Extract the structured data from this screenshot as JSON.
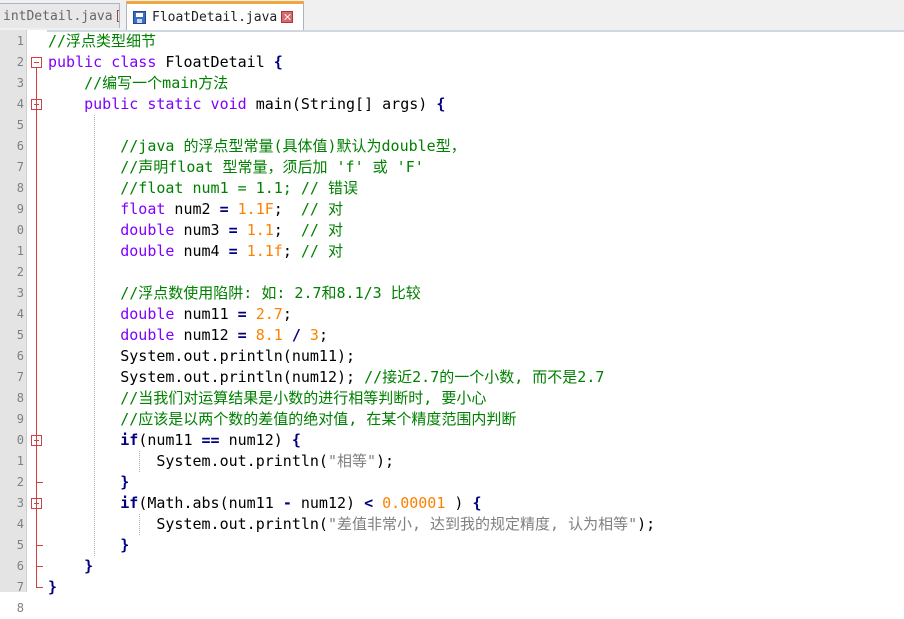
{
  "tabs": [
    {
      "label": "FloatDetail.java",
      "visible_label": "intDetail.java",
      "active": false
    },
    {
      "label": "FloatDetail.java",
      "active": true
    }
  ],
  "line_numbers": [
    "1",
    "2",
    "3",
    "4",
    "5",
    "6",
    "7",
    "8",
    "9",
    "0",
    "1",
    "2",
    "3",
    "4",
    "5",
    "6",
    "7",
    "8",
    "9",
    "0",
    "1",
    "2",
    "3",
    "4",
    "5",
    "6",
    "7",
    "8"
  ],
  "code_lines": [
    [
      {
        "t": "//浮点类型细节",
        "c": "cm"
      }
    ],
    [
      {
        "t": "public class",
        "c": "kw"
      },
      {
        "t": " FloatDetail ",
        "c": "tx"
      },
      {
        "t": "{",
        "c": "op"
      }
    ],
    [
      {
        "t": "    //编写一个main方法",
        "c": "cm"
      }
    ],
    [
      {
        "t": "    ",
        "c": "tx"
      },
      {
        "t": "public static void",
        "c": "kw"
      },
      {
        "t": " main(String[] args) ",
        "c": "tx"
      },
      {
        "t": "{",
        "c": "op"
      }
    ],
    [],
    [
      {
        "t": "        //java 的浮点型常量(具体值)默认为double型，",
        "c": "cm"
      }
    ],
    [
      {
        "t": "        //声明float 型常量，须后加 'f' 或 'F'",
        "c": "cm"
      }
    ],
    [
      {
        "t": "        //float num1 = 1.1; // 错误",
        "c": "cm"
      }
    ],
    [
      {
        "t": "        ",
        "c": "tx"
      },
      {
        "t": "float",
        "c": "kw"
      },
      {
        "t": " num2 ",
        "c": "tx"
      },
      {
        "t": "=",
        "c": "op"
      },
      {
        "t": " ",
        "c": "tx"
      },
      {
        "t": "1.1F",
        "c": "num"
      },
      {
        "t": ";  ",
        "c": "tx"
      },
      {
        "t": "// 对",
        "c": "cm"
      }
    ],
    [
      {
        "t": "        ",
        "c": "tx"
      },
      {
        "t": "double",
        "c": "kw"
      },
      {
        "t": " num3 ",
        "c": "tx"
      },
      {
        "t": "=",
        "c": "op"
      },
      {
        "t": " ",
        "c": "tx"
      },
      {
        "t": "1.1",
        "c": "num"
      },
      {
        "t": ";  ",
        "c": "tx"
      },
      {
        "t": "// 对",
        "c": "cm"
      }
    ],
    [
      {
        "t": "        ",
        "c": "tx"
      },
      {
        "t": "double",
        "c": "kw"
      },
      {
        "t": " num4 ",
        "c": "tx"
      },
      {
        "t": "=",
        "c": "op"
      },
      {
        "t": " ",
        "c": "tx"
      },
      {
        "t": "1.1f",
        "c": "num"
      },
      {
        "t": "; ",
        "c": "tx"
      },
      {
        "t": "// 对",
        "c": "cm"
      }
    ],
    [],
    [
      {
        "t": "        //浮点数使用陷阱: 如: 2.7和8.1/3 比较",
        "c": "cm"
      }
    ],
    [
      {
        "t": "        ",
        "c": "tx"
      },
      {
        "t": "double",
        "c": "kw"
      },
      {
        "t": " num11 ",
        "c": "tx"
      },
      {
        "t": "=",
        "c": "op"
      },
      {
        "t": " ",
        "c": "tx"
      },
      {
        "t": "2.7",
        "c": "num"
      },
      {
        "t": ";",
        "c": "tx"
      }
    ],
    [
      {
        "t": "        ",
        "c": "tx"
      },
      {
        "t": "double",
        "c": "kw"
      },
      {
        "t": " num12 ",
        "c": "tx"
      },
      {
        "t": "=",
        "c": "op"
      },
      {
        "t": " ",
        "c": "tx"
      },
      {
        "t": "8.1",
        "c": "num"
      },
      {
        "t": " ",
        "c": "tx"
      },
      {
        "t": "/",
        "c": "op"
      },
      {
        "t": " ",
        "c": "tx"
      },
      {
        "t": "3",
        "c": "num"
      },
      {
        "t": ";",
        "c": "tx"
      }
    ],
    [
      {
        "t": "        System.out.println(num11);",
        "c": "tx"
      }
    ],
    [
      {
        "t": "        System.out.println(num12); ",
        "c": "tx"
      },
      {
        "t": "//接近2.7的一个小数, 而不是2.7",
        "c": "cm"
      }
    ],
    [
      {
        "t": "        //当我们对运算结果是小数的进行相等判断时, 要小心",
        "c": "cm"
      }
    ],
    [
      {
        "t": "        //应该是以两个数的差值的绝对值, 在某个精度范围内判断",
        "c": "cm"
      }
    ],
    [
      {
        "t": "        ",
        "c": "tx"
      },
      {
        "t": "if",
        "c": "kwb"
      },
      {
        "t": "(num11 ",
        "c": "tx"
      },
      {
        "t": "==",
        "c": "op"
      },
      {
        "t": " num12) ",
        "c": "tx"
      },
      {
        "t": "{",
        "c": "op"
      }
    ],
    [
      {
        "t": "            System.out.println(",
        "c": "tx"
      },
      {
        "t": "\"相等\"",
        "c": "str"
      },
      {
        "t": ");",
        "c": "tx"
      }
    ],
    [
      {
        "t": "        ",
        "c": "tx"
      },
      {
        "t": "}",
        "c": "op"
      }
    ],
    [
      {
        "t": "        ",
        "c": "tx"
      },
      {
        "t": "if",
        "c": "kwb"
      },
      {
        "t": "(Math.abs(num11 ",
        "c": "tx"
      },
      {
        "t": "-",
        "c": "op"
      },
      {
        "t": " num12) ",
        "c": "tx"
      },
      {
        "t": "<",
        "c": "op"
      },
      {
        "t": " ",
        "c": "tx"
      },
      {
        "t": "0.00001",
        "c": "num"
      },
      {
        "t": " ) ",
        "c": "tx"
      },
      {
        "t": "{",
        "c": "op"
      }
    ],
    [
      {
        "t": "            System.out.println(",
        "c": "tx"
      },
      {
        "t": "\"差值非常小, 达到我的规定精度, 认为相等\"",
        "c": "str"
      },
      {
        "t": ");",
        "c": "tx"
      }
    ],
    [
      {
        "t": "        ",
        "c": "tx"
      },
      {
        "t": "}",
        "c": "op"
      }
    ],
    [
      {
        "t": "    ",
        "c": "tx"
      },
      {
        "t": "}",
        "c": "op"
      }
    ],
    [
      {
        "t": "}",
        "c": "op"
      }
    ],
    []
  ],
  "fold_lines": [
    2,
    4,
    20,
    23
  ],
  "colors": {
    "comment": "#008000",
    "keyword": "#8000ff",
    "number": "#ff8000",
    "operator": "#000080",
    "string": "#808080",
    "active_tab_accent": "#f0a83c",
    "fold_marker": "#d04040"
  }
}
